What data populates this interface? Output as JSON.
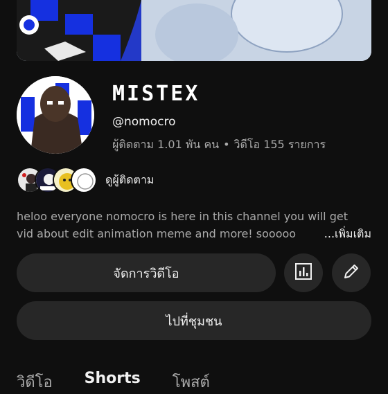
{
  "channel": {
    "name": "MISTEX",
    "handle": "@nomocro",
    "subscribers": "ผู้ติดตาม 1.01 พัน คน",
    "separator": "•",
    "videos": "วิดีโอ 155 รายการ"
  },
  "subscribers_link": "ดูผู้ติดตาม",
  "description": {
    "line1": "heloo everyone nomocro is here in this channel you will get",
    "line2": "vid about edit animation meme and more! sooooo",
    "more": "...เพิ่มเติม"
  },
  "buttons": {
    "manage_videos": "จัดการวิดีโอ",
    "community": "ไปที่ชุมชน"
  },
  "tabs": [
    {
      "label": "วิดีโอ",
      "active": false
    },
    {
      "label": "Shorts",
      "active": true
    },
    {
      "label": "โพสต์",
      "active": false
    }
  ],
  "icons": {
    "stats": "analytics-icon",
    "edit": "pencil-icon"
  },
  "colors": {
    "background": "#0f0f0f",
    "button": "#272727",
    "secondary_text": "#aaaaaa",
    "accent_blue": "#1530e0"
  }
}
